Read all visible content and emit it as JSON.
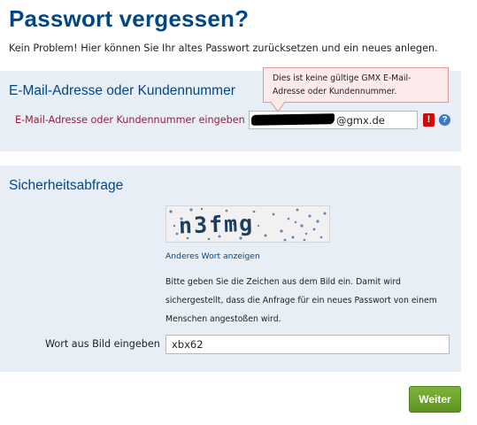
{
  "page": {
    "title": "Passwort vergessen?",
    "intro": "Kein Problem! Hier können Sie Ihr altes Passwort zurücksetzen und ein neues anlegen."
  },
  "email_section": {
    "title": "E-Mail-Adresse oder Kundennummer",
    "label": "E-Mail-Adresse oder Kundennummer eingeben",
    "value": "@gmx.de",
    "error_icon": "!",
    "help_icon": "?",
    "tooltip_line1": "Dies ist keine gültige GMX E-Mail-",
    "tooltip_line2": "Adresse oder Kundennummer."
  },
  "captcha_section": {
    "title": "Sicherheitsabfrage",
    "captcha_text": "n3fmg",
    "reload_link": "Anderes Wort anzeigen",
    "help_text": "Bitte geben Sie die Zeichen aus dem Bild ein. Damit wird sichergestellt, dass die Anfrage für ein neues Passwort von einem Menschen angestoßen wird.",
    "input_label": "Wort aus Bild eingeben",
    "input_value": "xbx62"
  },
  "actions": {
    "next": "Weiter"
  },
  "colors": {
    "brand_blue": "#004788",
    "panel_bg": "#e8eef6",
    "error_red": "#cc0a0a",
    "label_red": "#9b1b3c",
    "button_green": "#6fa52e",
    "tooltip_bg": "#fdeaea"
  }
}
